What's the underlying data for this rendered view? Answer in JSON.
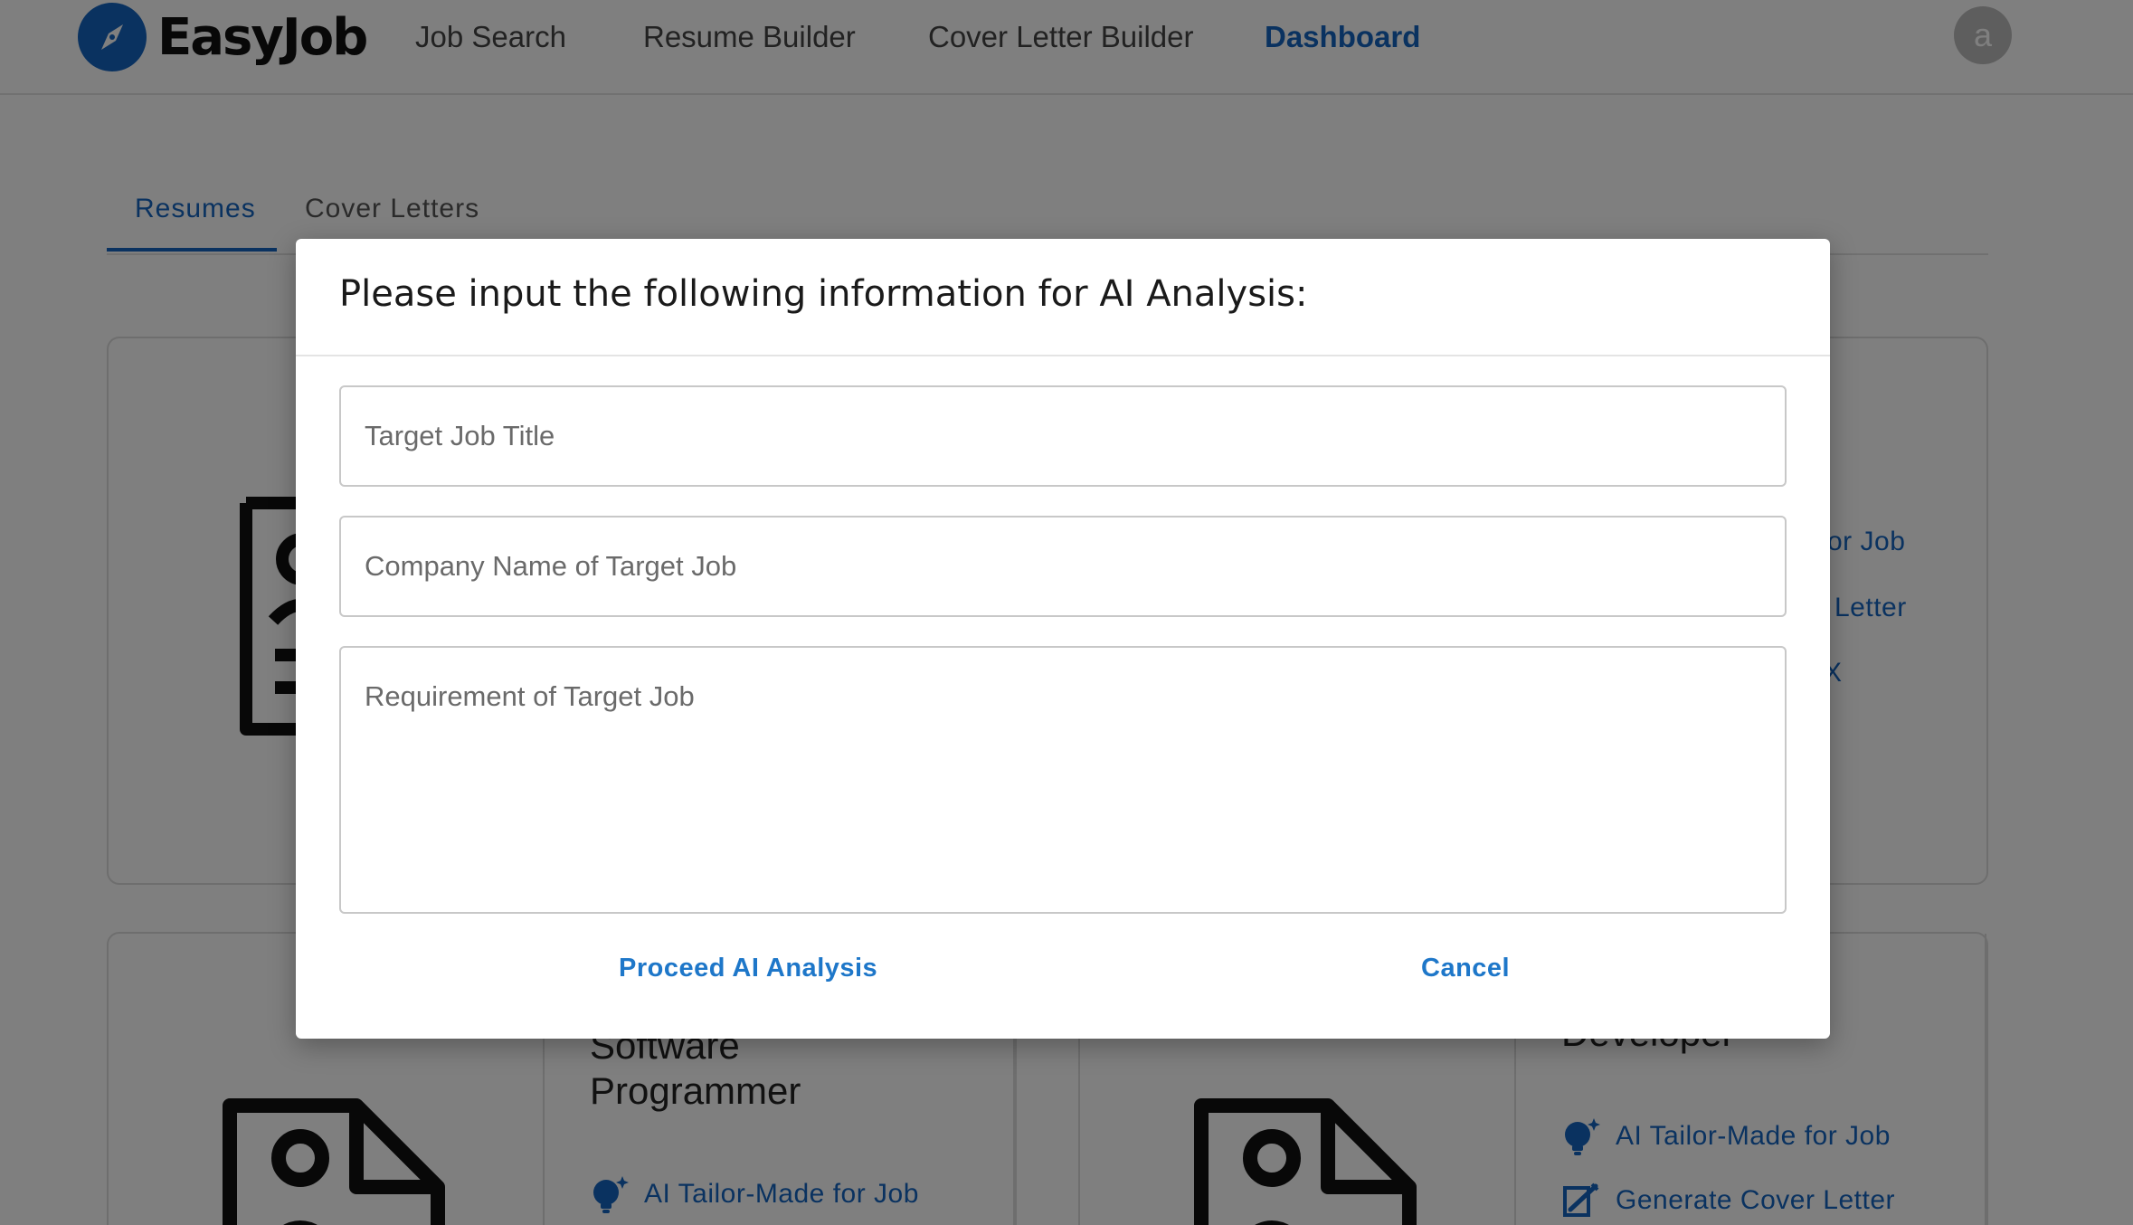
{
  "app": {
    "logo_text": "EasyJob"
  },
  "nav": {
    "job_search": "Job Search",
    "resume_builder": "Resume Builder",
    "cover_letter_builder": "Cover Letter Builder",
    "dashboard": "Dashboard"
  },
  "user": {
    "avatar_letter": "a"
  },
  "tabs": {
    "resumes": "Resumes",
    "cover_letters": "Cover Letters"
  },
  "cards": {
    "card1": {
      "actions": {
        "ai_tailor": "or Job",
        "cover_letter": "Letter",
        "third": "X"
      }
    },
    "card3": {
      "title_partial": "Software",
      "title": "Programmer",
      "actions": {
        "ai_tailor": "AI Tailor-Made for Job"
      }
    },
    "card4": {
      "title_partial": "Developer",
      "actions": {
        "ai_tailor": "AI Tailor-Made for Job",
        "cover_letter": "Generate Cover Letter"
      }
    }
  },
  "modal": {
    "title": "Please input the following information for AI Analysis:",
    "target_job_title_placeholder": "Target Job Title",
    "company_name_placeholder": "Company Name of Target Job",
    "requirement_placeholder": "Requirement of Target Job",
    "proceed_label": "Proceed AI Analysis",
    "cancel_label": "Cancel"
  },
  "colors": {
    "accent": "#1565c0",
    "button_text": "#1e77c9",
    "overlay": "rgba(0,0,0,0.5)"
  },
  "icons": [
    "compass-icon",
    "resume-document-icon",
    "lightbulb-sparkle-icon",
    "generate-letter-icon"
  ]
}
